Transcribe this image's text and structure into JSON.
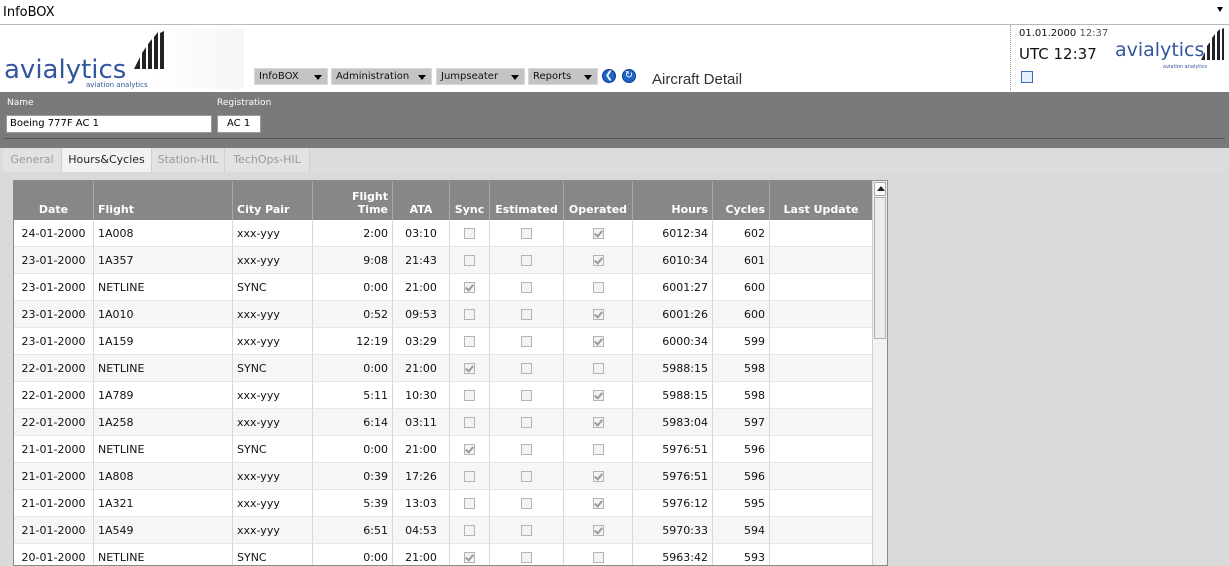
{
  "window": {
    "title": "InfoBOX"
  },
  "header": {
    "logo_text": "avialytics",
    "logo_sub": "aviation analytics",
    "menus": [
      {
        "label": "InfoBOX"
      },
      {
        "label": "Administration"
      },
      {
        "label": "Jumpseater"
      },
      {
        "label": "Reports"
      }
    ],
    "page_title": "Aircraft Detail",
    "date": "01.01.2000",
    "time": "12:37",
    "utc": "UTC 12:37"
  },
  "form": {
    "name_label": "Name",
    "name_value": "Boeing 777F AC 1",
    "registration_label": "Registration",
    "registration_value": "AC 1"
  },
  "tabs": [
    {
      "label": "General",
      "active": false
    },
    {
      "label": "Hours&Cycles",
      "active": true
    },
    {
      "label": "Station-HIL",
      "active": false
    },
    {
      "label": "TechOps-HIL",
      "active": false
    }
  ],
  "table": {
    "columns": {
      "date": "Date",
      "flight": "Flight",
      "city_pair": "City Pair",
      "flight_time_1": "Flight",
      "flight_time_2": "Time",
      "ata": "ATA",
      "sync": "Sync",
      "estimated": "Estimated",
      "operated": "Operated",
      "hours": "Hours",
      "cycles": "Cycles",
      "last_update": "Last Update"
    },
    "rows": [
      {
        "date": "24-01-2000",
        "flight": "1A008",
        "city_pair": "xxx-yyy",
        "flight_time": "2:00",
        "ata": "03:10",
        "sync": false,
        "estimated": false,
        "operated": true,
        "hours": "6012:34",
        "cycles": "602",
        "last_update": ""
      },
      {
        "date": "23-01-2000",
        "flight": "1A357",
        "city_pair": "xxx-yyy",
        "flight_time": "9:08",
        "ata": "21:43",
        "sync": false,
        "estimated": false,
        "operated": true,
        "hours": "6010:34",
        "cycles": "601",
        "last_update": ""
      },
      {
        "date": "23-01-2000",
        "flight": "NETLINE",
        "city_pair": "SYNC",
        "flight_time": "0:00",
        "ata": "21:00",
        "sync": true,
        "estimated": false,
        "operated": false,
        "hours": "6001:27",
        "cycles": "600",
        "last_update": ""
      },
      {
        "date": "23-01-2000",
        "flight": "1A010",
        "city_pair": "xxx-yyy",
        "flight_time": "0:52",
        "ata": "09:53",
        "sync": false,
        "estimated": false,
        "operated": true,
        "hours": "6001:26",
        "cycles": "600",
        "last_update": ""
      },
      {
        "date": "23-01-2000",
        "flight": "1A159",
        "city_pair": "xxx-yyy",
        "flight_time": "12:19",
        "ata": "03:29",
        "sync": false,
        "estimated": false,
        "operated": true,
        "hours": "6000:34",
        "cycles": "599",
        "last_update": ""
      },
      {
        "date": "22-01-2000",
        "flight": "NETLINE",
        "city_pair": "SYNC",
        "flight_time": "0:00",
        "ata": "21:00",
        "sync": true,
        "estimated": false,
        "operated": false,
        "hours": "5988:15",
        "cycles": "598",
        "last_update": ""
      },
      {
        "date": "22-01-2000",
        "flight": "1A789",
        "city_pair": "xxx-yyy",
        "flight_time": "5:11",
        "ata": "10:30",
        "sync": false,
        "estimated": false,
        "operated": true,
        "hours": "5988:15",
        "cycles": "598",
        "last_update": ""
      },
      {
        "date": "22-01-2000",
        "flight": "1A258",
        "city_pair": "xxx-yyy",
        "flight_time": "6:14",
        "ata": "03:11",
        "sync": false,
        "estimated": false,
        "operated": true,
        "hours": "5983:04",
        "cycles": "597",
        "last_update": ""
      },
      {
        "date": "21-01-2000",
        "flight": "NETLINE",
        "city_pair": "SYNC",
        "flight_time": "0:00",
        "ata": "21:00",
        "sync": true,
        "estimated": false,
        "operated": false,
        "hours": "5976:51",
        "cycles": "596",
        "last_update": ""
      },
      {
        "date": "21-01-2000",
        "flight": "1A808",
        "city_pair": "xxx-yyy",
        "flight_time": "0:39",
        "ata": "17:26",
        "sync": false,
        "estimated": false,
        "operated": true,
        "hours": "5976:51",
        "cycles": "596",
        "last_update": ""
      },
      {
        "date": "21-01-2000",
        "flight": "1A321",
        "city_pair": "xxx-yyy",
        "flight_time": "5:39",
        "ata": "13:03",
        "sync": false,
        "estimated": false,
        "operated": true,
        "hours": "5976:12",
        "cycles": "595",
        "last_update": ""
      },
      {
        "date": "21-01-2000",
        "flight": "1A549",
        "city_pair": "xxx-yyy",
        "flight_time": "6:51",
        "ata": "04:53",
        "sync": false,
        "estimated": false,
        "operated": true,
        "hours": "5970:33",
        "cycles": "594",
        "last_update": ""
      },
      {
        "date": "20-01-2000",
        "flight": "NETLINE",
        "city_pair": "SYNC",
        "flight_time": "0:00",
        "ata": "21:00",
        "sync": true,
        "estimated": false,
        "operated": false,
        "hours": "5963:42",
        "cycles": "593",
        "last_update": ""
      }
    ]
  },
  "colors": {
    "brand": "#33569e",
    "header_gray": "#878787",
    "band_gray": "#7a7a7a",
    "nav_blue": "#1f63c6"
  }
}
